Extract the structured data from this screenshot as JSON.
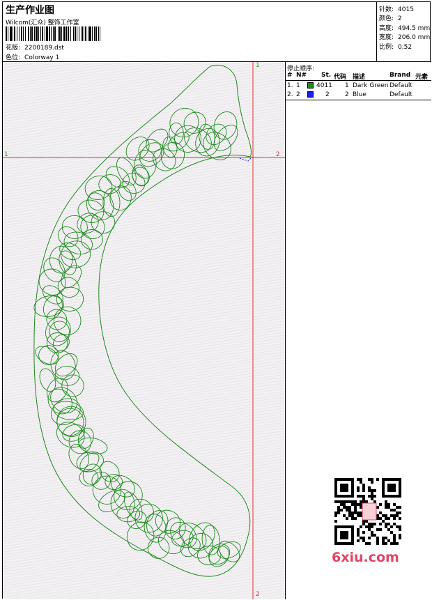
{
  "header": {
    "title": "生产作业图",
    "company": "Wilcom(汇众) 整饰工作室",
    "design_label": "花版:",
    "design_value": "2200189.dst",
    "colorway_label": "色位:",
    "colorway_value": "Colorway 1"
  },
  "stats": [
    {
      "label": "针数:",
      "value": "4015"
    },
    {
      "label": "颜色:",
      "value": "2"
    },
    {
      "label": "高度:",
      "value": "494.5 mm"
    },
    {
      "label": "宽度:",
      "value": "206.0 mm"
    },
    {
      "label": "比例:",
      "value": "0.52"
    }
  ],
  "stop_sequence": {
    "title": "停止顺序:",
    "columns": [
      "#",
      "N#",
      "St.",
      "代码",
      "描述",
      "Brand",
      "元素"
    ],
    "rows": [
      {
        "index": "1.",
        "n": "1",
        "color": "#1a8a1a",
        "stitches": "4011",
        "code": "1",
        "description": "Dark Green",
        "brand": "Default"
      },
      {
        "index": "2.",
        "n": "2",
        "color": "#1f1fe0",
        "stitches": "2",
        "code": "2",
        "description": "Blue",
        "brand": "Default"
      }
    ]
  },
  "markers": {
    "top": "1",
    "left": "1",
    "right": "2",
    "bottom": "2"
  },
  "watermark": "6xiu.com",
  "colors": {
    "stitch_green": "#1a8a1a",
    "guide_red": "#e03030",
    "guide_green": "#22aa22"
  }
}
